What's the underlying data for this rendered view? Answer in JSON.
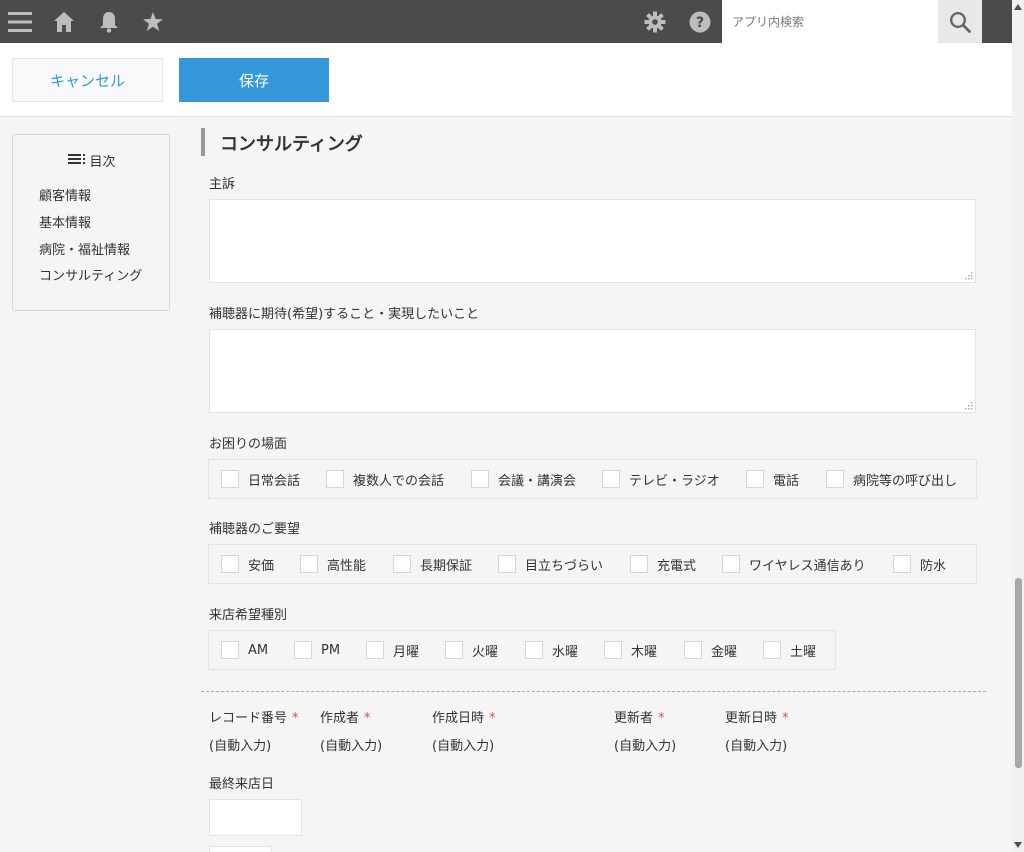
{
  "topbar": {
    "icons": [
      "menu-icon",
      "home-icon",
      "bell-icon",
      "star-icon",
      "gear-icon",
      "help-icon",
      "search-icon"
    ],
    "search_placeholder": "アプリ内検索"
  },
  "actions": {
    "cancel_label": "キャンセル",
    "save_label": "保存"
  },
  "toc": {
    "title": "目次",
    "items": [
      "顧客情報",
      "基本情報",
      "病院・福祉情報",
      "コンサルティング"
    ]
  },
  "section": {
    "title": "コンサルティング",
    "fields": {
      "complaint_label": "主訴",
      "expectation_label": "補聴器に期待(希望)すること・実現したいこと",
      "scenes_label": "お困りの場面",
      "scenes": [
        "日常会話",
        "複数人での会話",
        "会議・講演会",
        "テレビ・ラジオ",
        "電話",
        "病院等の呼び出し"
      ],
      "requests_label": "補聴器のご要望",
      "requests": [
        "安価",
        "高性能",
        "長期保証",
        "目立ちづらい",
        "充電式",
        "ワイヤレス通信あり",
        "防水"
      ],
      "visit_label": "来店希望種別",
      "visit": [
        "AM",
        "PM",
        "月曜",
        "火曜",
        "水曜",
        "木曜",
        "金曜",
        "土曜"
      ]
    }
  },
  "system_fields": {
    "required_mark": "*",
    "items": [
      {
        "label": "レコード番号",
        "value": "(自動入力)"
      },
      {
        "label": "作成者",
        "value": "(自動入力)"
      },
      {
        "label": "作成日時",
        "value": "(自動入力)"
      },
      {
        "label": "更新者",
        "value": "(自動入力)"
      },
      {
        "label": "更新日時",
        "value": "(自動入力)"
      }
    ],
    "last_visit_label": "最終来店日"
  },
  "colors": {
    "topbar_bg": "#4b4b4b",
    "accent": "#3498db",
    "required": "#e74c3c"
  }
}
